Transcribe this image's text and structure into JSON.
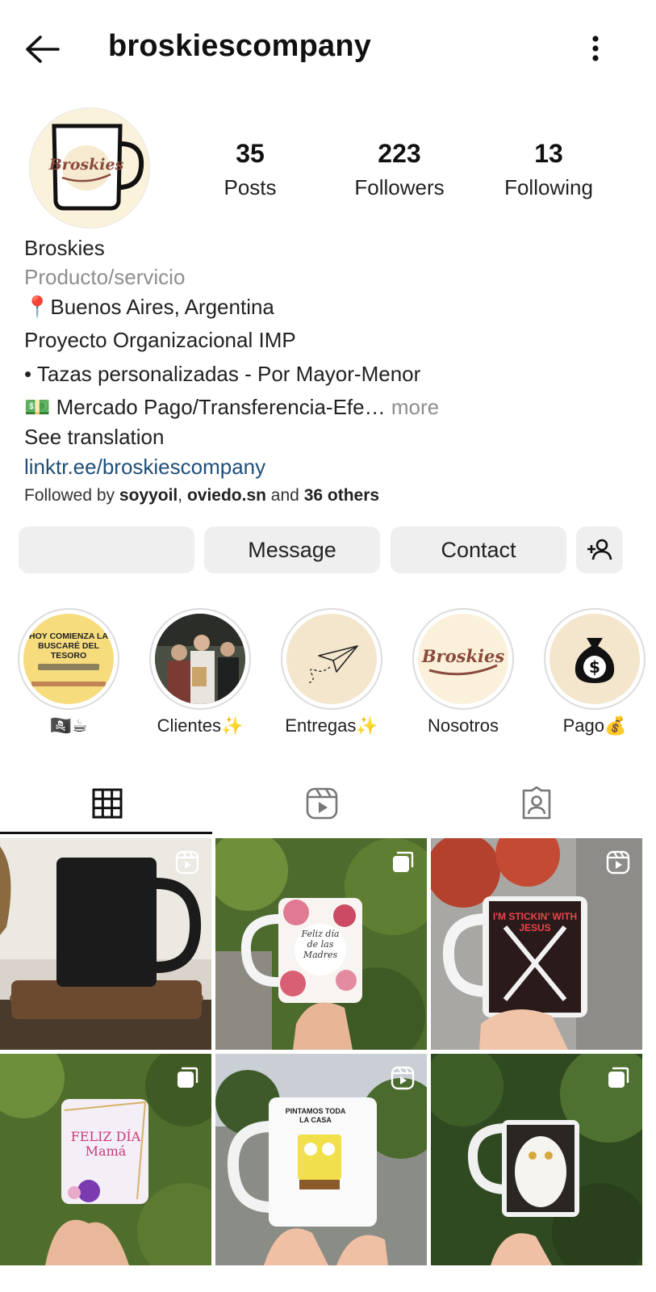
{
  "header": {
    "username": "broskiescompany",
    "back_icon": "arrow-left-icon",
    "menu_icon": "more-vertical-icon"
  },
  "profile": {
    "avatar_text": "Broskies",
    "stats": [
      {
        "value": "35",
        "label": "Posts"
      },
      {
        "value": "223",
        "label": "Followers"
      },
      {
        "value": "13",
        "label": "Following"
      }
    ]
  },
  "bio": {
    "name": "Broskies",
    "category": "Producto/servicio",
    "location": "📍Buenos Aires, Argentina",
    "line1": "Proyecto Organizacional  IMP",
    "line2": "• Tazas personalizadas - Por Mayor-Menor",
    "line3": "💵 Mercado Pago/Transferencia-Efe…",
    "more": "more",
    "see_translation": "See translation",
    "link": "linktr.ee/broskiescompany",
    "followed_prefix": "Followed by ",
    "followed_user1": "soyyoil",
    "followed_sep": ", ",
    "followed_user2": "oviedo.sn",
    "followed_and": " and ",
    "followed_others": "36 others"
  },
  "actions": {
    "follow_label": "",
    "message_label": "Message",
    "contact_label": "Contact",
    "add_person_icon": "person-add-icon"
  },
  "highlights": [
    {
      "label": "🏴‍☠️☕",
      "cover_text": "HOY COMIENZA LA BUSCARÉ DEL TESORO"
    },
    {
      "label": "Clientes✨"
    },
    {
      "label": "Entregas✨"
    },
    {
      "label": "Nosotros",
      "cover_text": "Broskies"
    },
    {
      "label": "Pago💰"
    }
  ],
  "tabs": [
    {
      "name": "grid",
      "icon": "grid-icon"
    },
    {
      "name": "reels",
      "icon": "reels-icon"
    },
    {
      "name": "tagged",
      "icon": "tagged-icon"
    }
  ],
  "posts": [
    {
      "kind": "reel",
      "caption": ""
    },
    {
      "kind": "carousel",
      "caption": "Feliz día de las Madres"
    },
    {
      "kind": "reel",
      "caption": "I'M STICKIN' WITH JESUS"
    },
    {
      "kind": "carousel",
      "caption": "FELIZ DÍA Mamá"
    },
    {
      "kind": "reel",
      "caption": "PINTAMOS TODA LA CASA"
    },
    {
      "kind": "carousel",
      "caption": ""
    }
  ],
  "colors": {
    "link": "#1f4e79",
    "muted": "#8e8e8e",
    "button_bg": "#efefef"
  }
}
